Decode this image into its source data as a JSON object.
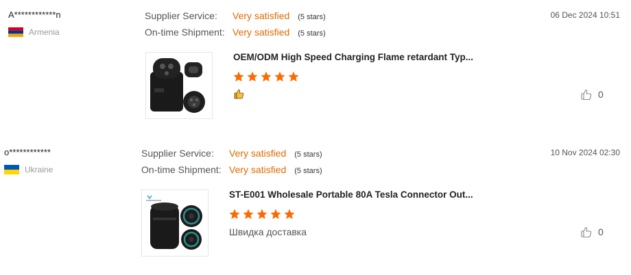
{
  "reviews": [
    {
      "reviewer": "A************n",
      "country": "Armenia",
      "ratings": [
        {
          "label": "Supplier Service:",
          "value": "Very satisfied",
          "stars": "(5 stars)"
        },
        {
          "label": "On-time Shipment:",
          "value": "Very satisfied",
          "stars": "(5 stars)"
        }
      ],
      "date": "06 Dec 2024 10:51",
      "product_title": "OEM/ODM High Speed Charging Flame retardant Typ...",
      "star_rating": 5,
      "comment_icon": "thumbs-up-emoji",
      "like_count": "0"
    },
    {
      "reviewer": "o************",
      "country": "Ukraine",
      "ratings": [
        {
          "label": "Supplier Service:",
          "value": "Very satisfied",
          "stars": "(5 stars)"
        },
        {
          "label": "On-time Shipment:",
          "value": "Very satisfied",
          "stars": "(5 stars)"
        }
      ],
      "date": "10 Nov 2024 02:30",
      "product_title": "ST-E001 Wholesale Portable 80A Tesla Connector Out...",
      "star_rating": 5,
      "comment": "Швидка доставка",
      "like_count": "0"
    }
  ],
  "colors": {
    "accent": "#e06a00",
    "star": "#ff6a00"
  }
}
